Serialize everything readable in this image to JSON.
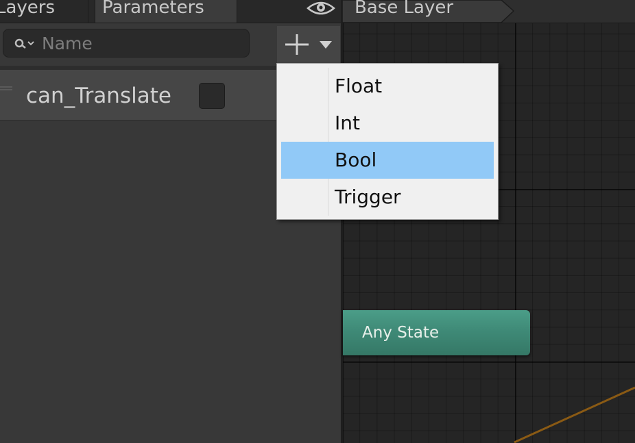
{
  "tabs": {
    "layers": "Layers",
    "parameters": "Parameters"
  },
  "toolbar": {
    "eye_icon": "eye-icon",
    "breadcrumb": "Base Layer"
  },
  "search": {
    "placeholder": "Name",
    "icon": "search-icon"
  },
  "add_button": {
    "icons": [
      "plus-icon",
      "chevron-down-icon"
    ]
  },
  "parameters": [
    {
      "name": "can_Translate",
      "type": "Bool",
      "checked": false
    }
  ],
  "dropdown": {
    "items": [
      {
        "label": "Float",
        "selected": false
      },
      {
        "label": "Int",
        "selected": false
      },
      {
        "label": "Bool",
        "selected": true
      },
      {
        "label": "Trigger",
        "selected": false
      }
    ],
    "highlight_color": "#91c9f7"
  },
  "graph": {
    "nodes": [
      {
        "label": "Any State",
        "color": "#3f8a77"
      }
    ],
    "transition_color": "#8a5a14"
  }
}
